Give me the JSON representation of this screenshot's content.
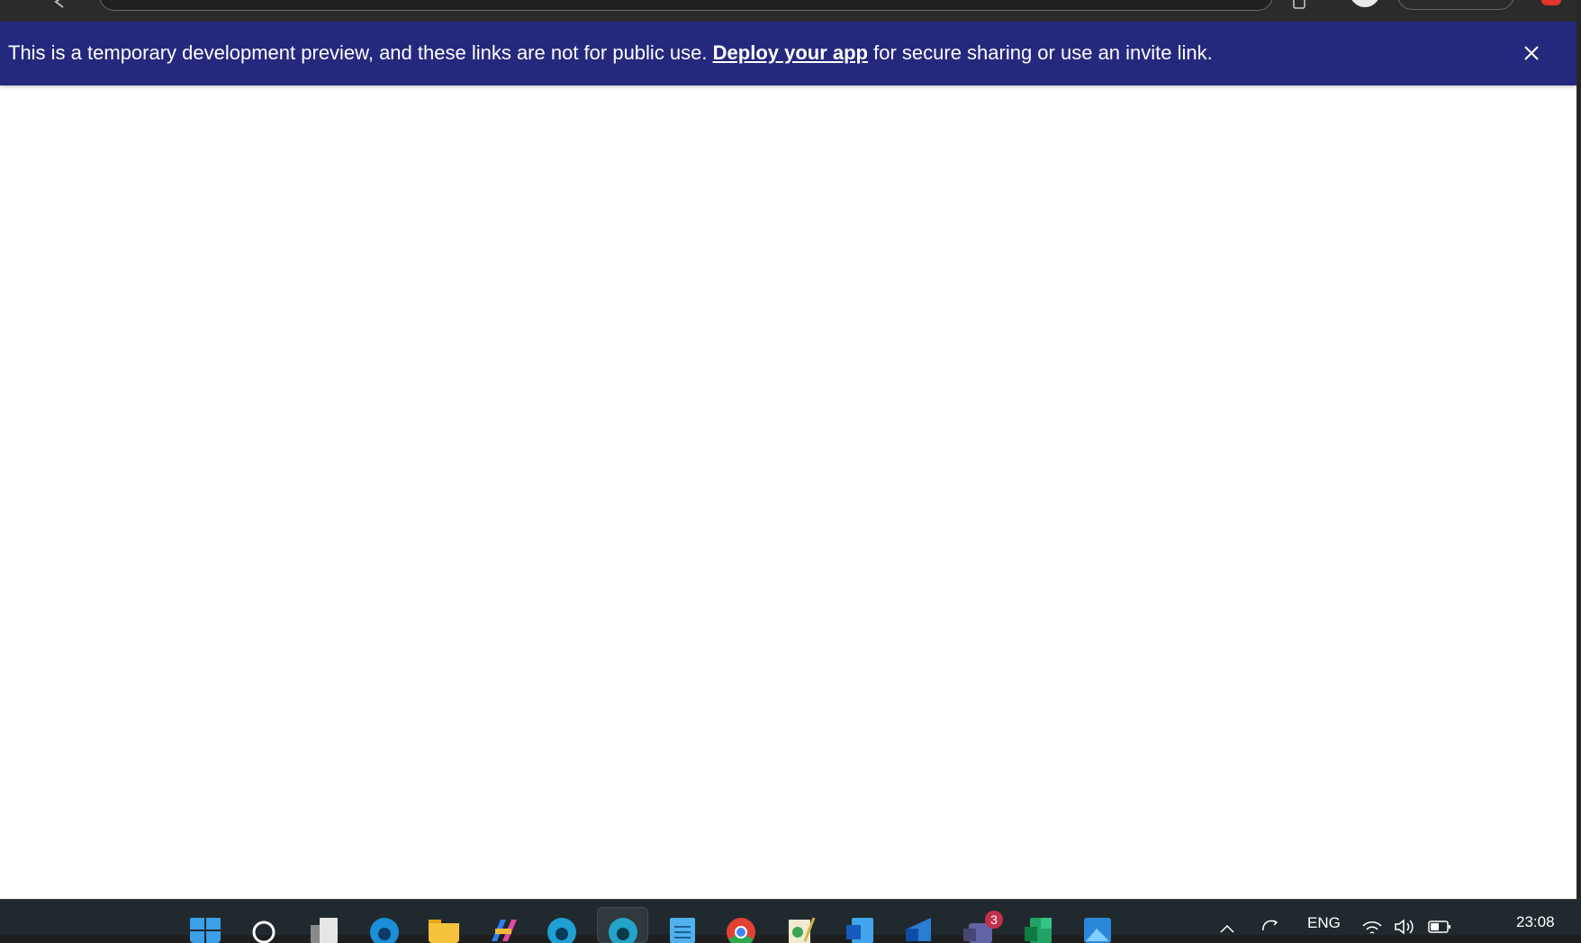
{
  "browser": {
    "address_text": "",
    "icons": [
      "back-icon",
      "extensions-icon",
      "profile-icon",
      "extension-red-icon"
    ]
  },
  "banner": {
    "text_before": "This is a temporary development preview, and these links are not for public use.",
    "link_label": "Deploy your app",
    "text_after": " for secure sharing or use an invite link.",
    "background_color": "#25297e",
    "close_icon": "close-icon"
  },
  "taskbar": {
    "apps": [
      "windows-start-icon",
      "search-icon",
      "task-view-icon",
      "edge-icon",
      "file-explorer-icon",
      "copilot-icon",
      "edge-beta-icon",
      "edge-dev-icon",
      "notepad-icon",
      "chrome-icon",
      "paint-icon",
      "word-icon",
      "outlook-icon",
      "teams-icon",
      "excel-icon",
      "photos-icon"
    ],
    "teams_badge_count": "3",
    "language": "ENG",
    "clock": "23:08",
    "tray_icons": [
      "chevron-up-icon",
      "sync-icon",
      "wifi-icon",
      "volume-icon",
      "battery-icon"
    ]
  }
}
